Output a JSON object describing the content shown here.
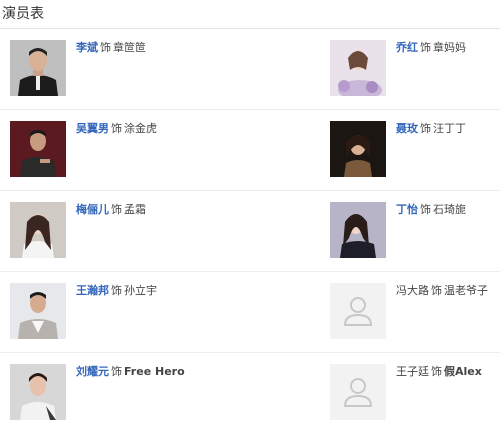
{
  "header": {
    "title": "演员表"
  },
  "cast": [
    {
      "actor": "李斌",
      "as": "饰",
      "role": "章笸笸",
      "linked": true,
      "photo": "photo-1"
    },
    {
      "actor": "乔红",
      "as": "饰",
      "role": "章妈妈",
      "linked": true,
      "photo": "photo-2"
    },
    {
      "actor": "吴翼男",
      "as": "饰",
      "role": "涂金虎",
      "linked": true,
      "photo": "photo-3"
    },
    {
      "actor": "聂玫",
      "as": "饰",
      "role": "汪丁丁",
      "linked": true,
      "photo": "photo-4"
    },
    {
      "actor": "梅俪儿",
      "as": "饰",
      "role": "孟霜",
      "linked": true,
      "photo": "photo-5"
    },
    {
      "actor": "丁怡",
      "as": "饰",
      "role": "石琦旎",
      "linked": true,
      "photo": "photo-6"
    },
    {
      "actor": "王瀚邦",
      "as": "饰",
      "role": "孙立宇",
      "linked": true,
      "photo": "photo-7"
    },
    {
      "actor": "冯大路",
      "as": "饰",
      "role": "温老爷子",
      "linked": false,
      "photo": "placeholder"
    },
    {
      "actor": "刘耀元",
      "as": "饰",
      "role": "Free Hero",
      "linked": true,
      "photo": "photo-8"
    },
    {
      "actor": "王子廷",
      "as": "饰",
      "role": "假Alex",
      "linked": false,
      "photo": "placeholder"
    }
  ],
  "colors": {
    "link": "#3366bb",
    "divider": "#ececec",
    "placeholder_bg": "#f2f2f2",
    "placeholder_icon": "#c8c8c8"
  }
}
